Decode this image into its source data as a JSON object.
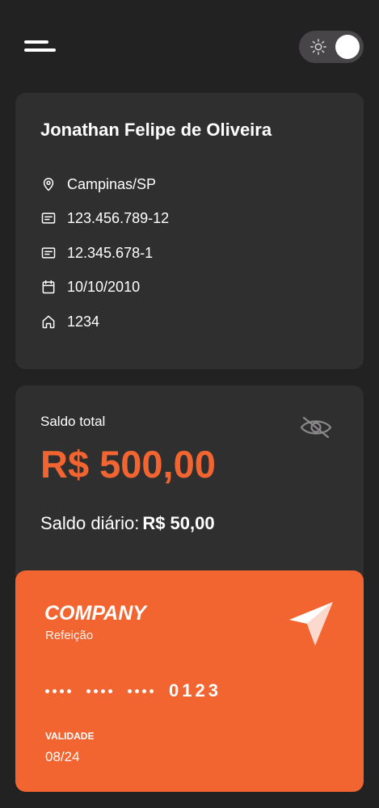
{
  "header": {
    "menu_icon": "hamburger-menu-icon",
    "theme_toggle": {
      "icon": "sun-icon",
      "state": "on"
    }
  },
  "profile": {
    "name": "Jonathan Felipe de Oliveira",
    "city": "Campinas/SP",
    "cpf": "123.456.789-12",
    "rg": "12.345.678-1",
    "birth_date": "10/10/2010",
    "house_number": "1234"
  },
  "balance": {
    "label": "Saldo total",
    "value": "R$ 500,00",
    "daily_label": "Saldo diário:",
    "daily_value": "R$ 50,00",
    "visibility_icon": "eye-off-icon"
  },
  "card": {
    "company": "COMPANY",
    "type": "Refeição",
    "last_digits": "0123",
    "validity_label": "VALIDADE",
    "validity_value": "08/24",
    "icon": "send-arrow-icon"
  },
  "colors": {
    "background": "#232223",
    "card_surface": "#302f30",
    "accent": "#f26430",
    "toggle_track": "#474547"
  }
}
